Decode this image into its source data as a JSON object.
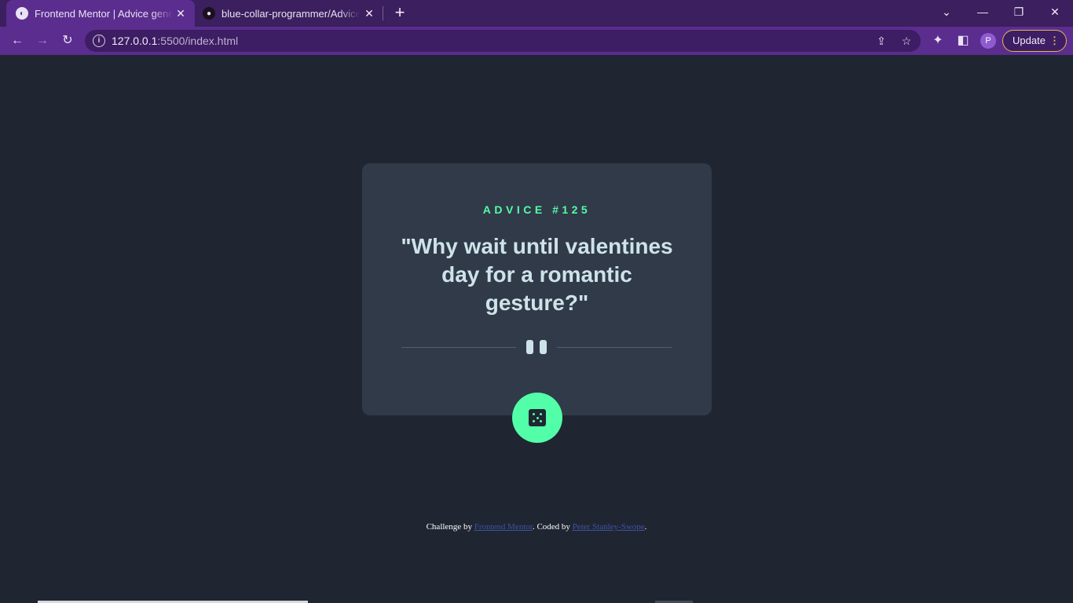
{
  "browser": {
    "tabs": [
      {
        "title": "Frontend Mentor | Advice generator app",
        "active": true
      },
      {
        "title": "blue-collar-programmer/Advice-generator",
        "active": false
      }
    ],
    "url_host": "127.0.0.1",
    "url_rest": ":5500/index.html",
    "profile_initial": "P",
    "update_label": "Update"
  },
  "advice": {
    "id_label": "ADVICE #125",
    "text": "\"Why wait until valentines day for a romantic gesture?\""
  },
  "footer": {
    "prefix": "Challenge by ",
    "challenge_link": "Frontend Mentor",
    "middle": ". Coded by ",
    "author_link": "Peter Stanley-Swope",
    "suffix": "."
  },
  "colors": {
    "background": "#1f2632",
    "card": "#313a48",
    "accent": "#52ffa8",
    "text": "#cee3e9",
    "browser_frame": "#5b2d8f"
  }
}
